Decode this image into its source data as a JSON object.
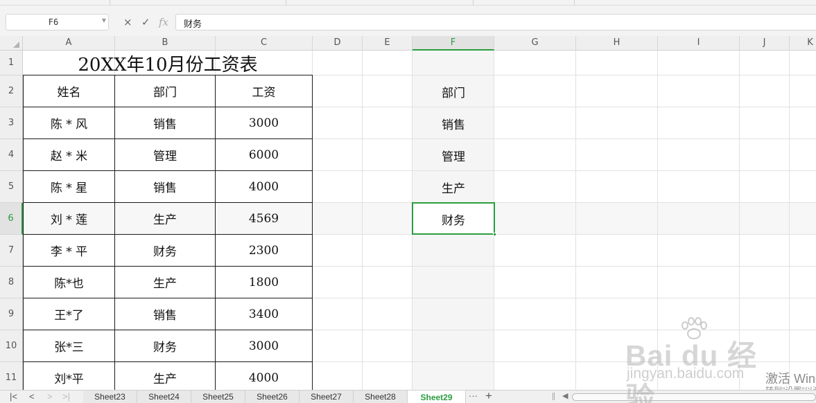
{
  "formula_bar": {
    "name_box": "F6",
    "cancel_symbol": "×",
    "confirm_symbol": "✓",
    "fx_label": "fx",
    "content": "财务"
  },
  "columns": [
    "A",
    "B",
    "C",
    "D",
    "E",
    "F",
    "G",
    "H",
    "I",
    "J",
    "K"
  ],
  "rows": [
    "1",
    "2",
    "3",
    "4",
    "5",
    "6",
    "7",
    "8",
    "9",
    "10",
    "11"
  ],
  "active_cell": {
    "column": "F",
    "row": "6"
  },
  "table": {
    "title": "20XX年10月份工资表",
    "headers": [
      "姓名",
      "部门",
      "工资"
    ],
    "records": [
      [
        "陈 * 风",
        "销售",
        "3000"
      ],
      [
        "赵 * 米",
        "管理",
        "6000"
      ],
      [
        "陈 * 星",
        "销售",
        "4000"
      ],
      [
        "刘 * 莲",
        "生产",
        "4569"
      ],
      [
        "李 * 平",
        "财务",
        "2300"
      ],
      [
        "陈*也",
        "生产",
        "1800"
      ],
      [
        "王*了",
        "销售",
        "3400"
      ],
      [
        "张*三",
        "财务",
        "3000"
      ],
      [
        "刘*平",
        "生产",
        "4000"
      ]
    ]
  },
  "column_f": [
    "部门",
    "销售",
    "管理",
    "生产",
    "财务"
  ],
  "sheet_tabs": {
    "tabs": [
      "Sheet23",
      "Sheet24",
      "Sheet25",
      "Sheet26",
      "Sheet27",
      "Sheet28",
      "Sheet29"
    ],
    "active": "Sheet29",
    "more": "···",
    "add": "+"
  },
  "watermark": {
    "logo": "Bai du 经验",
    "url": "jingyan.baidu.com"
  },
  "windows_activation": {
    "line1": "激活 Windows",
    "line2": "转到\"设置\"以激活 Windows。"
  },
  "colors": {
    "accent_green": "#2a9d3f",
    "header_bg": "#efefef",
    "gridline": "#e1e1e1",
    "table_border": "#1a1a1a"
  }
}
